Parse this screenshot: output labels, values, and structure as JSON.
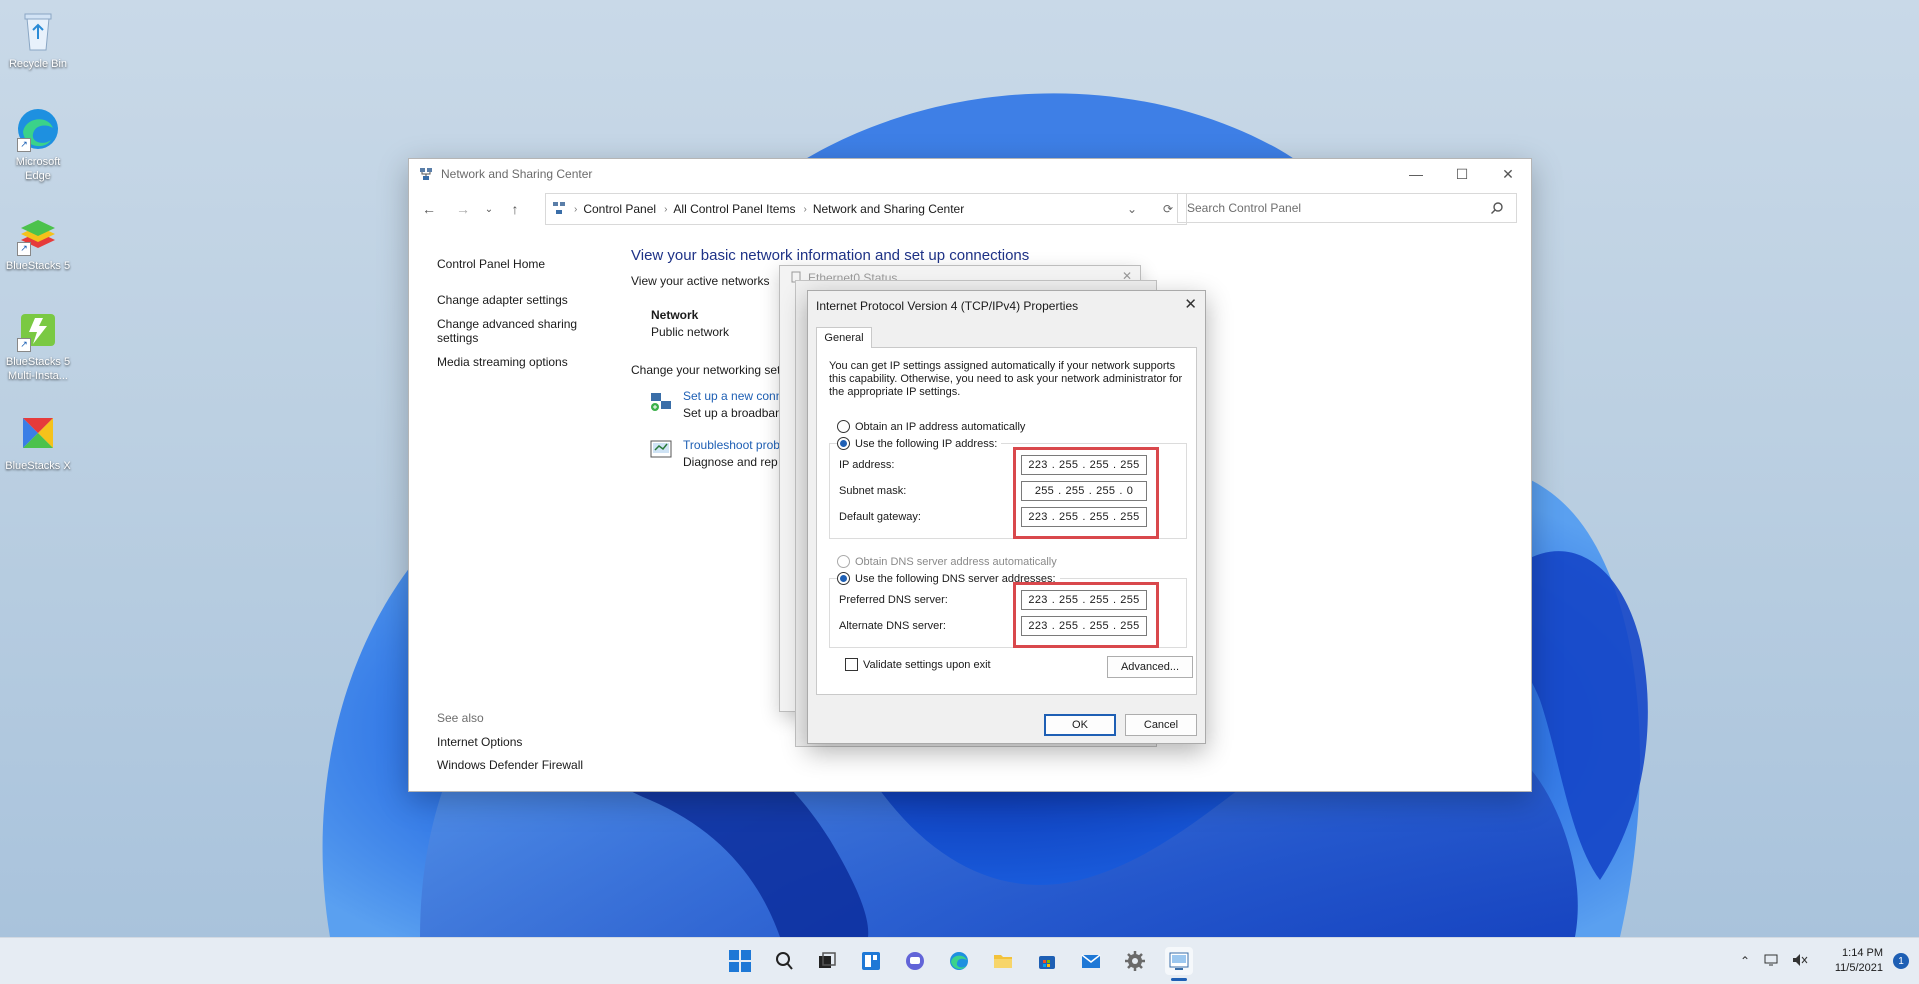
{
  "desktop": {
    "icons": [
      {
        "label": "Recycle Bin",
        "icon": "recycle-bin-icon"
      },
      {
        "label": "Microsoft Edge",
        "icon": "edge-icon"
      },
      {
        "label": "BlueStacks 5",
        "icon": "bluestacks-icon"
      },
      {
        "label": "BlueStacks 5 Multi-Insta...",
        "icon": "bluestacks-multi-icon"
      },
      {
        "label": "BlueStacks X",
        "icon": "bluestacks-x-icon"
      }
    ]
  },
  "window": {
    "title": "Network and Sharing Center",
    "breadcrumbs": [
      "Control Panel",
      "All Control Panel Items",
      "Network and Sharing Center"
    ],
    "search_placeholder": "Search Control Panel",
    "left_links": [
      "Control Panel Home",
      "Change adapter settings",
      "Change advanced sharing settings",
      "Media streaming options"
    ],
    "see_also": {
      "header": "See also",
      "links": [
        "Internet Options",
        "Windows Defender Firewall"
      ]
    },
    "heading": "View your basic network information and set up connections",
    "active_networks_label": "View your active networks",
    "network_name": "Network",
    "network_type": "Public network",
    "change_settings_label": "Change your networking set",
    "tasks": [
      {
        "link": "Set up a new conn",
        "desc": "Set up a broadban"
      },
      {
        "link": "Troubleshoot prob",
        "desc": "Diagnose and rep"
      }
    ]
  },
  "ethernet_dialog": {
    "title": "Ethernet0 Status"
  },
  "ipv4_dialog": {
    "title": "Internet Protocol Version 4 (TCP/IPv4) Properties",
    "tab": "General",
    "intro": "You can get IP settings assigned automatically if your network supports this capability. Otherwise, you need to ask your network administrator for the appropriate IP settings.",
    "obtain_ip_auto": "Obtain an IP address automatically",
    "use_following_ip": "Use the following IP address:",
    "ip_label": "IP address:",
    "ip_value": [
      "223",
      "255",
      "255",
      "255"
    ],
    "subnet_label": "Subnet mask:",
    "subnet_value": [
      "255",
      "255",
      "255",
      "0"
    ],
    "gateway_label": "Default gateway:",
    "gateway_value": [
      "223",
      "255",
      "255",
      "255"
    ],
    "obtain_dns_auto": "Obtain DNS server address automatically",
    "use_following_dns": "Use the following DNS server addresses:",
    "preferred_dns_label": "Preferred DNS server:",
    "preferred_dns_value": [
      "223",
      "255",
      "255",
      "255"
    ],
    "alternate_dns_label": "Alternate DNS server:",
    "alternate_dns_value": [
      "223",
      "255",
      "255",
      "255"
    ],
    "validate_label": "Validate settings upon exit",
    "advanced_label": "Advanced...",
    "ok_label": "OK",
    "cancel_label": "Cancel"
  },
  "taskbar": {
    "time": "1:14 PM",
    "date": "11/5/2021",
    "notification_count": "1"
  },
  "colors": {
    "accent": "#1e5fb4",
    "highlight_box": "#d9484c",
    "heading": "#1e3287"
  }
}
